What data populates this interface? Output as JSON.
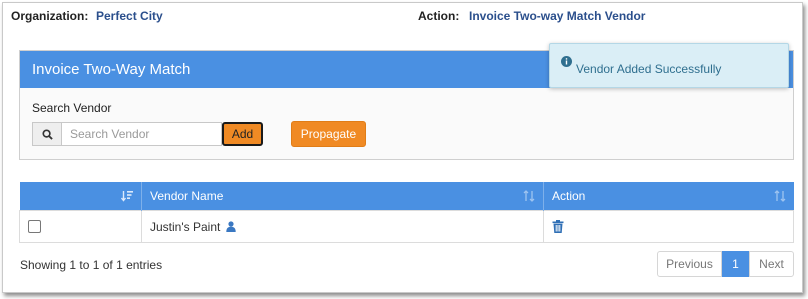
{
  "context": {
    "organization_label": "Organization:",
    "organization_value": "Perfect City",
    "action_label": "Action:",
    "action_value": "Invoice Two-way Match Vendor"
  },
  "panel": {
    "title": "Invoice Two-Way Match",
    "search_label": "Search Vendor",
    "search_placeholder": "Search Vendor",
    "search_value": "",
    "add_label": "Add",
    "propagate_label": "Propagate"
  },
  "toast": {
    "icon": "info-circle-icon",
    "message": "Vendor Added Successfully"
  },
  "table": {
    "columns": [
      {
        "label": "",
        "icon": "sort-amount-icon"
      },
      {
        "label": "Vendor Name",
        "icon": "sort-icon"
      },
      {
        "label": "Action",
        "icon": "sort-icon"
      }
    ],
    "rows": [
      {
        "checked": false,
        "vendor_name": "Justin's Paint",
        "vendor_icon": "user-icon",
        "action_icon": "trash-icon"
      }
    ]
  },
  "footer": {
    "info": "Showing 1 to 1 of 1 entries",
    "previous": "Previous",
    "current_page": "1",
    "next": "Next"
  },
  "colors": {
    "accent": "#4a90e2",
    "button": "#f08a24",
    "link": "#2b4f8c",
    "toast_bg": "#daeef6"
  }
}
